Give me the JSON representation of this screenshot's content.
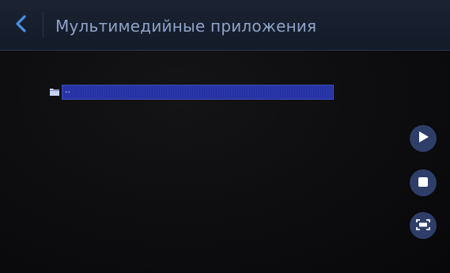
{
  "header": {
    "title": "Мультимедийные приложения",
    "back_icon": "chevron-left-icon"
  },
  "file_list": {
    "items": [
      {
        "label": "..",
        "icon": "folder-icon",
        "selected": true
      }
    ]
  },
  "controls": {
    "play_icon": "play-icon",
    "stop_icon": "stop-icon",
    "fullscreen_icon": "fullscreen-icon"
  },
  "colors": {
    "header_bg": "#1b2333",
    "title_text": "#8fa3c7",
    "accent": "#4a8fe6",
    "selection": "#2b37a8",
    "button_bg": "#2f3e69"
  }
}
